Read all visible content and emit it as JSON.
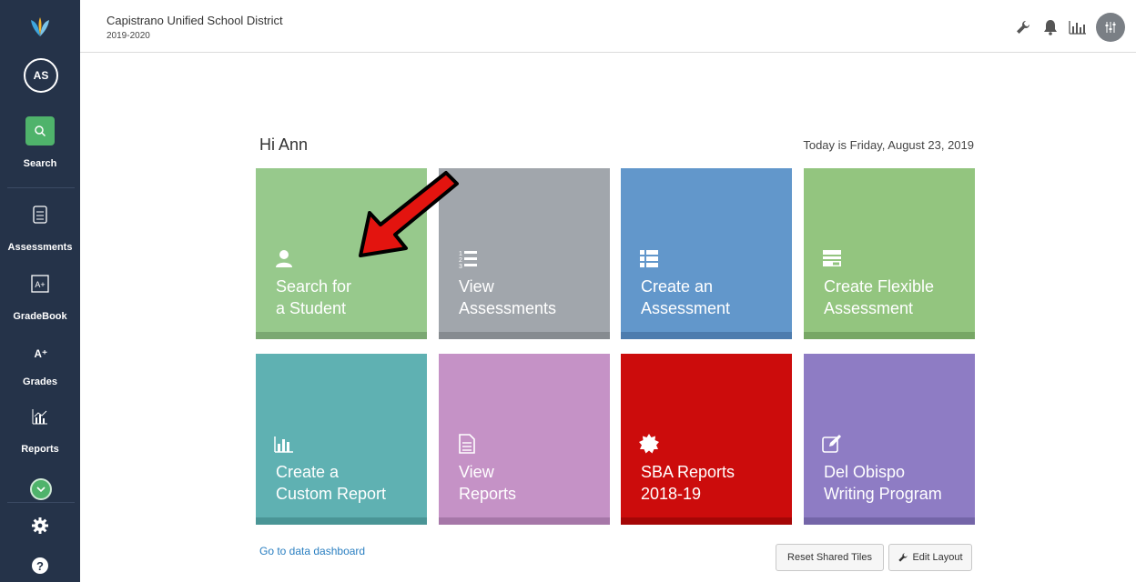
{
  "sidebar": {
    "avatar_initials": "AS",
    "items": [
      {
        "label": "Search",
        "icon": "search-icon"
      },
      {
        "label": "Assessments",
        "icon": "clipboard-icon"
      },
      {
        "label": "GradeBook",
        "icon": "gradebook-icon"
      },
      {
        "label": "Grades",
        "icon": "grades-icon"
      },
      {
        "label": "Reports",
        "icon": "reports-icon"
      }
    ]
  },
  "header": {
    "district": "Capistrano Unified School District",
    "year": "2019-2020"
  },
  "main": {
    "greeting": "Hi Ann",
    "today": "Today is Friday, August 23, 2019",
    "tiles": [
      {
        "line1": "Search for",
        "line2": "a Student",
        "icon": "user-icon",
        "color": "#97c98c"
      },
      {
        "line1": "View",
        "line2": "Assessments",
        "icon": "numbered-list-icon",
        "color": "#a1a6ac"
      },
      {
        "line1": "Create an",
        "line2": "Assessment",
        "icon": "list-icon",
        "color": "#6297cb"
      },
      {
        "line1": "Create Flexible",
        "line2": "Assessment",
        "icon": "form-icon",
        "color": "#93c57f"
      },
      {
        "line1": "Create a",
        "line2": "Custom Report",
        "icon": "bar-chart-icon",
        "color": "#5fb1b2"
      },
      {
        "line1": "View",
        "line2": "Reports",
        "icon": "document-icon",
        "color": "#c592c6"
      },
      {
        "line1": "SBA Reports",
        "line2": "2018-19",
        "icon": "badge-icon",
        "color": "#cc0c0c"
      },
      {
        "line1": "Del Obispo",
        "line2": "Writing Program",
        "icon": "edit-icon",
        "color": "#8e7cc4"
      }
    ],
    "dashboard_link": "Go to data dashboard",
    "reset_button": "Reset Shared Tiles",
    "edit_button": "Edit Layout"
  }
}
